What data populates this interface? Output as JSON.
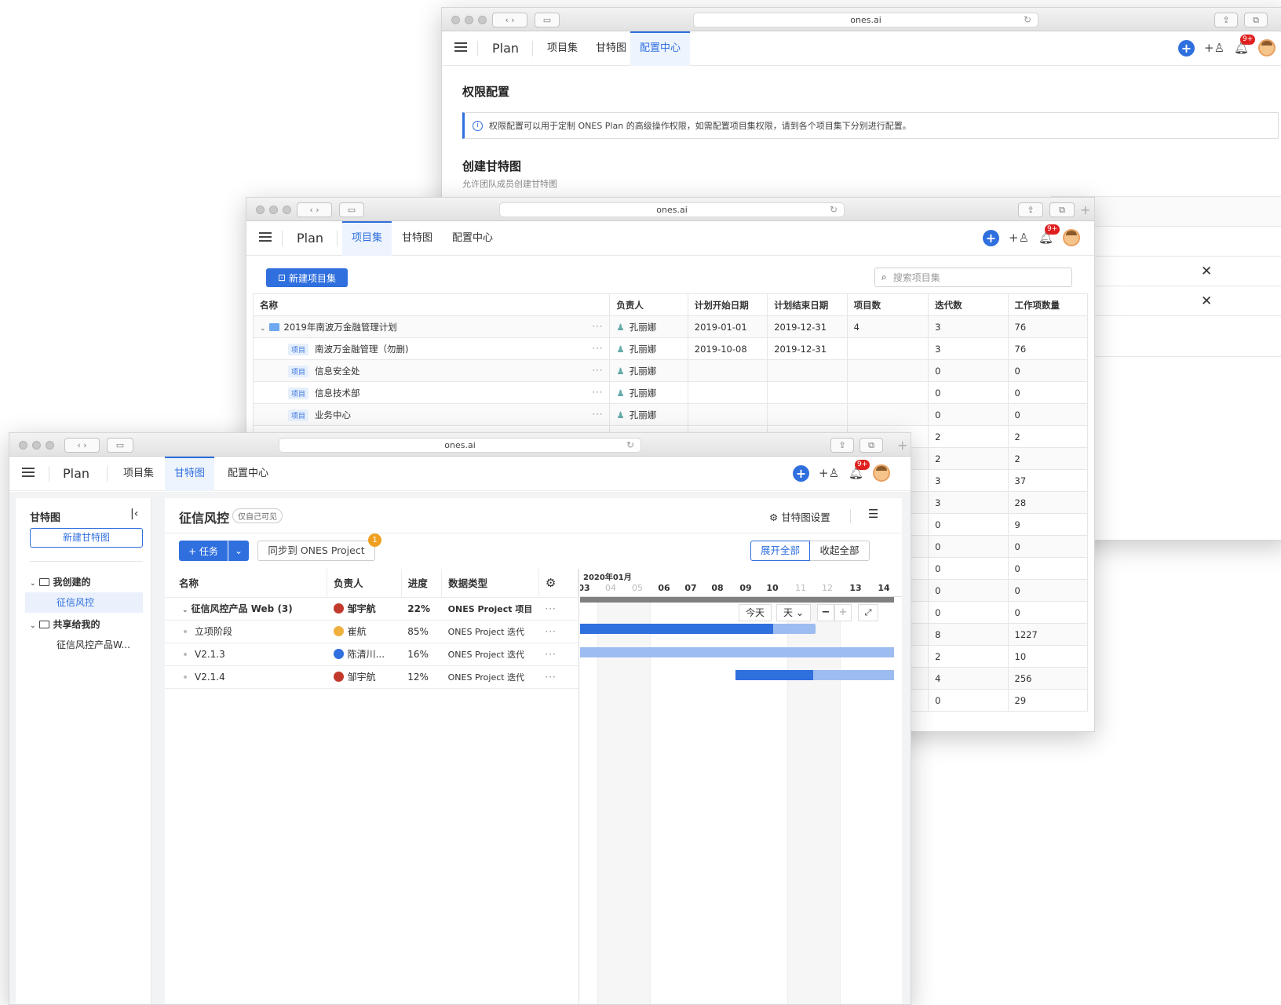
{
  "url": "ones.ai",
  "app": {
    "brand": "Plan",
    "tab_projects": "项目集",
    "tab_gantt": "甘特图",
    "tab_config": "配置中心",
    "notif_badge": "9+"
  },
  "back": {
    "title": "权限配置",
    "info": "权限配置可以用于定制 ONES Plan 的高级操作权限，如需配置项目集权限，请到各个项目集下分别进行配置。",
    "section_title": "创建甘特图",
    "section_desc": "允许团队成员创建甘特图"
  },
  "mid": {
    "new_button": "新建项目集",
    "search_placeholder": "搜索项目集",
    "columns": [
      "名称",
      "负责人",
      "计划开始日期",
      "计划结束日期",
      "项目数",
      "迭代数",
      "工作项数量"
    ],
    "rows": [
      {
        "name": "2019年南波万金融管理计划",
        "tag": "",
        "owner": "孔丽娜",
        "start": "2019-01-01",
        "end": "2019-12-31",
        "projects": "4",
        "iters": "3",
        "items": "76"
      },
      {
        "name": "南波万金融管理（勿删)",
        "tag": "项目",
        "owner": "孔丽娜",
        "start": "2019-10-08",
        "end": "2019-12-31",
        "projects": "",
        "iters": "3",
        "items": "76"
      },
      {
        "name": "信息安全处",
        "tag": "项目",
        "owner": "孔丽娜",
        "start": "",
        "end": "",
        "projects": "",
        "iters": "0",
        "items": "0"
      },
      {
        "name": "信息技术部",
        "tag": "项目",
        "owner": "孔丽娜",
        "start": "",
        "end": "",
        "projects": "",
        "iters": "0",
        "items": "0"
      },
      {
        "name": "业务中心",
        "tag": "项目",
        "owner": "孔丽娜",
        "start": "",
        "end": "",
        "projects": "",
        "iters": "0",
        "items": "0"
      }
    ],
    "hidden_rows": [
      {
        "iters": "2",
        "items": "2"
      },
      {
        "iters": "2",
        "items": "2"
      },
      {
        "iters": "3",
        "items": "37"
      },
      {
        "iters": "3",
        "items": "28"
      },
      {
        "iters": "0",
        "items": "9"
      },
      {
        "iters": "0",
        "items": "0"
      },
      {
        "iters": "0",
        "items": "0"
      },
      {
        "iters": "0",
        "items": "0"
      },
      {
        "iters": "0",
        "items": "0"
      },
      {
        "iters": "8",
        "items": "1227"
      },
      {
        "iters": "2",
        "items": "10"
      },
      {
        "iters": "4",
        "items": "256"
      },
      {
        "iters": "0",
        "items": "29"
      }
    ]
  },
  "front": {
    "sidebar": {
      "title": "甘特图",
      "new_button": "新建甘特图",
      "group_mine": "我创建的",
      "item_mine": "征信风控",
      "group_shared": "共享给我的",
      "item_shared": "征信风控产品W..."
    },
    "gantt_title": "征信风控",
    "visibility": "仅自己可见",
    "settings": "甘特图设置",
    "task_button": "+ 任务",
    "sync_button": "同步到 ONES Project",
    "sync_badge": "1",
    "expand_all": "展开全部",
    "collapse_all": "收起全部",
    "columns": [
      "名称",
      "负责人",
      "进度",
      "数据类型"
    ],
    "rows": [
      {
        "name": "征信风控产品 Web (3)",
        "owner": "邹宇航",
        "progress": "22%",
        "type": "ONES Project 项目"
      },
      {
        "name": "立项阶段",
        "owner": "崔航",
        "progress": "85%",
        "type": "ONES Project 迭代"
      },
      {
        "name": "V2.1.3",
        "owner": "陈清川...",
        "progress": "16%",
        "type": "ONES Project 迭代"
      },
      {
        "name": "V2.1.4",
        "owner": "邹宇航",
        "progress": "12%",
        "type": "ONES Project 迭代"
      }
    ],
    "timeline": {
      "month": "2020年01月",
      "days": [
        "03",
        "04",
        "05",
        "06",
        "07",
        "08",
        "09",
        "10",
        "11",
        "12",
        "13",
        "14"
      ],
      "today": "今天",
      "scale": "天"
    }
  },
  "colors": {
    "accent": "#2f6fde",
    "bar_light": "#9dbcf0",
    "bar_dark": "#2f6fde"
  }
}
